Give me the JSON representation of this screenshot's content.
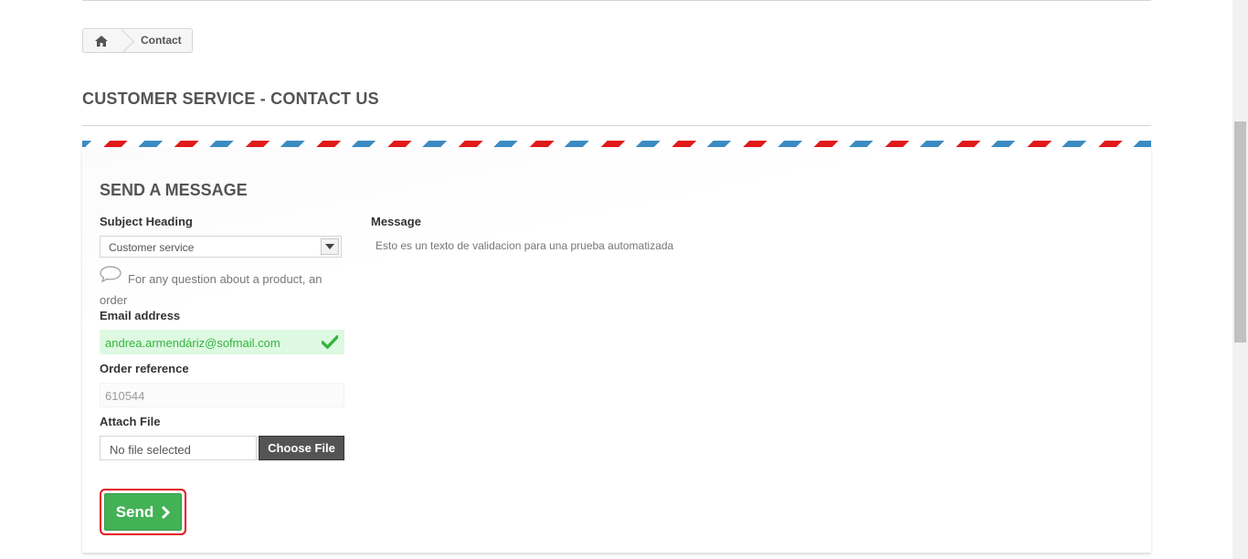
{
  "breadcrumb": {
    "home_icon": "home-icon",
    "current": "Contact"
  },
  "page": {
    "heading": "CUSTOMER SERVICE - CONTACT US"
  },
  "form": {
    "title": "SEND A MESSAGE",
    "subject_label": "Subject Heading",
    "subject_value": "Customer service",
    "subject_help": "For any question about a product, an order",
    "email_label": "Email address",
    "email_value": "andrea.armendáriz@sofmail.com",
    "order_label": "Order reference",
    "order_value": "610544",
    "attach_label": "Attach File",
    "file_name": "No file selected",
    "choose_file": "Choose File",
    "message_label": "Message",
    "message_value": "Esto es un texto de validacion para una prueba automatizada",
    "send_label": "Send"
  },
  "colors": {
    "stripe_blue": "#3b8bc2",
    "stripe_red": "#e11a1a",
    "send_green": "#43b155",
    "valid_green": "#35b33f",
    "valid_bg": "#ddf9e1",
    "highlight_red": "#e30e1a"
  }
}
